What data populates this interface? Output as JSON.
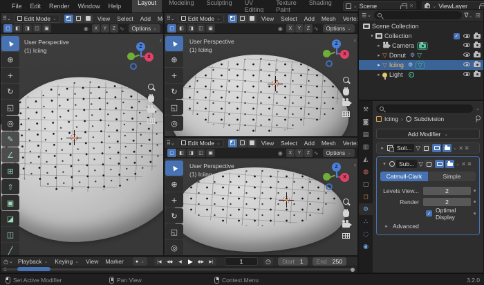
{
  "icons": {
    "chevron_down": "⌄",
    "dropdown_arrow": "▾",
    "expand_right": "▸",
    "expand_down": "▾",
    "collapse_left": "‹",
    "close": "✕",
    "check": "✓",
    "grid_glyph": "⠿",
    "clock": "◷",
    "record_dot": "●",
    "gear": "⚙",
    "mesh_triangle": "▽",
    "breadcrumb_sep": "›",
    "menu_grip": "≣",
    "funnel": "∇",
    "prop_edit": "◉",
    "falloff": "∿",
    "new_collection": "⊞",
    "list_mode": "☰"
  },
  "topbar": {
    "menus": [
      "File",
      "Edit",
      "Render",
      "Window",
      "Help"
    ],
    "tabs": [
      "Layout",
      "Modeling",
      "Sculpting",
      "UV Editing",
      "Texture Paint",
      "Shading"
    ],
    "scene": "Scene",
    "view_layer": "ViewLayer"
  },
  "viewport": {
    "mode": "Edit Mode",
    "menus": [
      "View",
      "Select",
      "Add",
      "Mesh",
      "Vertex"
    ],
    "options": "Options",
    "axes": [
      "X",
      "Y",
      "Z"
    ],
    "overlay": {
      "line1": "User Perspective",
      "line2": "(1) Iciing"
    },
    "gizmo": {
      "z": "Z",
      "x": "X"
    }
  },
  "select_tools": [
    "▢",
    "◧",
    "◨",
    "◫",
    "▣"
  ],
  "tools": [
    {
      "name": "select-box",
      "glyph": "▲"
    },
    {
      "name": "cursor",
      "glyph": "⊕"
    },
    {
      "name": "move",
      "glyph": "+"
    },
    {
      "name": "rotate",
      "glyph": "↻"
    },
    {
      "name": "scale",
      "glyph": "◱"
    },
    {
      "name": "transform",
      "glyph": "◎"
    },
    {
      "name": "annotate",
      "glyph": "✎"
    },
    {
      "name": "measure",
      "glyph": "∠"
    },
    {
      "name": "add-cube",
      "glyph": "⊞"
    },
    {
      "name": "extrude-region",
      "glyph": "⇧"
    },
    {
      "name": "inset-faces",
      "glyph": "▣"
    },
    {
      "name": "bevel",
      "glyph": "◪"
    },
    {
      "name": "loop-cut",
      "glyph": "◫"
    },
    {
      "name": "knife",
      "glyph": "╱"
    }
  ],
  "outliner": {
    "rows": [
      {
        "label": "Scene Collection"
      },
      {
        "label": "Collection"
      },
      {
        "label": "Camera"
      },
      {
        "label": "Donut"
      },
      {
        "label": "Iciing"
      },
      {
        "label": "Light"
      }
    ]
  },
  "prop_tabs": [
    {
      "name": "tool",
      "glyph": "⚒"
    },
    {
      "name": "render",
      "glyph": "◙"
    },
    {
      "name": "output",
      "glyph": "▤"
    },
    {
      "name": "view-layer",
      "glyph": "▥"
    },
    {
      "name": "scene",
      "glyph": "◭"
    },
    {
      "name": "world",
      "glyph": "◍"
    },
    {
      "name": "collection",
      "glyph": "▢"
    },
    {
      "name": "object",
      "glyph": "◻"
    },
    {
      "name": "modifiers",
      "glyph": "⚙"
    },
    {
      "name": "particles",
      "glyph": "∴"
    },
    {
      "name": "physics",
      "glyph": "◌"
    },
    {
      "name": "object-data",
      "glyph": "◉"
    }
  ],
  "properties": {
    "breadcrumb": {
      "object": "Iciing",
      "modifier": "Subdivision"
    },
    "add_modifier": "Add Modifier",
    "modifiers": {
      "solidify_name": "Soli...",
      "subdiv_name": "Sub...",
      "catmull": "Catmull-Clark",
      "simple": "Simple",
      "levels_label": "Levels View...",
      "levels_value": "2",
      "render_label": "Render",
      "render_value": "2",
      "optimal_label": "Optimal Display",
      "advanced_label": "Advanced"
    }
  },
  "timeline": {
    "menus": [
      "Playback",
      "Keying",
      "View",
      "Marker"
    ],
    "transport": [
      "|◀",
      "◀◆",
      "◀",
      "▶",
      "◆▶",
      "▶|"
    ],
    "frame": "1",
    "start_label": "Start",
    "start": "1",
    "end_label": "End",
    "end": "250"
  },
  "statusbar": {
    "hints": [
      "Set Active Modifier",
      "Pan View",
      "Context Menu"
    ],
    "version": "3.2.0"
  }
}
